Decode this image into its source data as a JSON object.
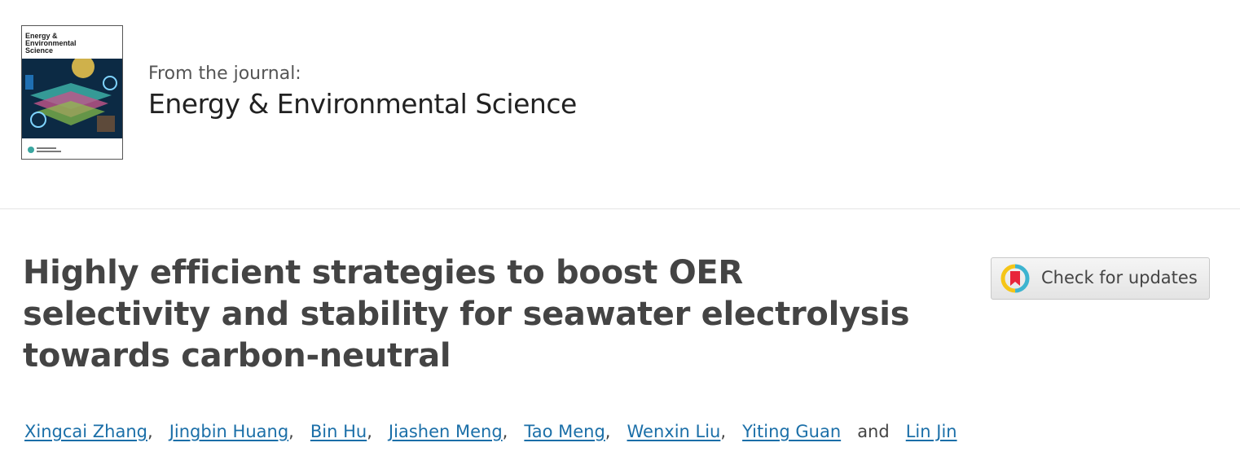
{
  "journal": {
    "cover_title": "Energy & Environmental Science",
    "from_label": "From the journal:",
    "name": "Energy & Environmental Science"
  },
  "article": {
    "title": "Highly efficient strategies to boost OER selectivity and stability for seawater electrolysis towards carbon-neutral"
  },
  "updates_button": {
    "label": "Check for updates",
    "icon": "crossmark-icon"
  },
  "authors": {
    "list": [
      "Xingcai Zhang",
      "Jingbin Huang",
      "Bin Hu",
      "Jiashen Meng",
      "Tao Meng",
      "Wenxin Liu",
      "Yiting Guan",
      "Lin Jin"
    ],
    "separator": ",",
    "conjunction": "and"
  },
  "colors": {
    "link": "#1b6fa8",
    "title": "#444444"
  }
}
